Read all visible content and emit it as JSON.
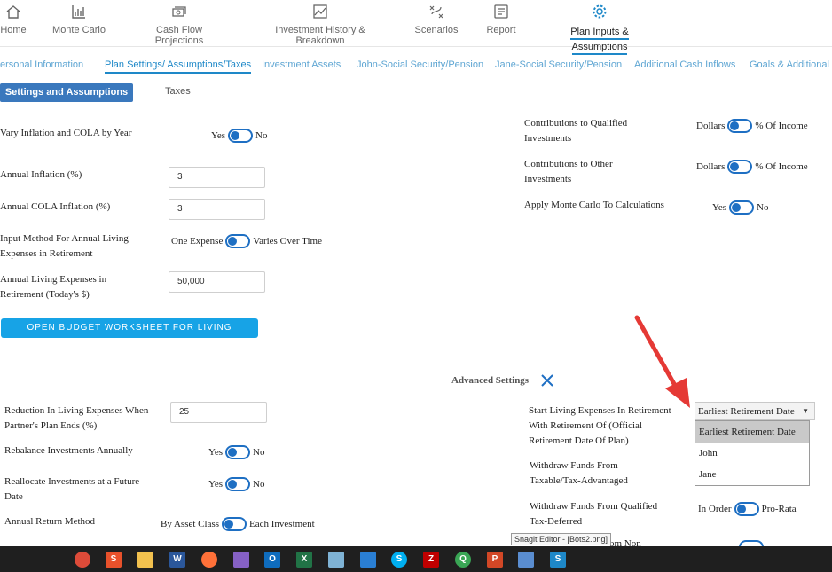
{
  "nav": {
    "items": [
      {
        "label": "Home",
        "icon": "home-icon"
      },
      {
        "label": "Monte Carlo",
        "icon": "bar-chart-icon"
      },
      {
        "label": "Cash Flow Projections",
        "icon": "cash-icon"
      },
      {
        "label": "Investment History & Breakdown",
        "icon": "image-chart-icon"
      },
      {
        "label": "Scenarios",
        "icon": "scenarios-icon"
      },
      {
        "label": "Report",
        "icon": "report-icon"
      },
      {
        "label": "Plan Inputs & Assumptions",
        "icon": "gear-icon"
      }
    ]
  },
  "subtabs": [
    "ersonal Information",
    "Plan Settings/ Assumptions/Taxes",
    "Investment Assets",
    "John-Social Security/Pension",
    "Jane-Social Security/Pension",
    "Additional Cash Inflows",
    "Goals & Additional E"
  ],
  "section_tabs": {
    "active": "Settings and Assumptions",
    "other": "Taxes"
  },
  "settings": {
    "vary_inflation": {
      "label": "Vary Inflation and COLA by Year",
      "left": "Yes",
      "right": "No"
    },
    "annual_inflation": {
      "label": "Annual Inflation (%)",
      "value": "3"
    },
    "annual_cola": {
      "label": "Annual COLA Inflation (%)",
      "value": "3"
    },
    "input_method": {
      "label": "Input Method For Annual Living Expenses in Retirement",
      "left": "One Expense",
      "right": "Varies Over Time"
    },
    "annual_living": {
      "label": "Annual Living Expenses in Retirement (Today's $)",
      "value": "50,000"
    },
    "budget_button": "OPEN BUDGET WORKSHEET FOR LIVING EXPENSES",
    "contrib_qualified": {
      "label": "Contributions to Qualified Investments",
      "left": "Dollars",
      "right": "% Of Income"
    },
    "contrib_other": {
      "label": "Contributions to Other Investments",
      "left": "Dollars",
      "right": "% Of Income"
    },
    "monte_carlo": {
      "label": "Apply Monte Carlo To Calculations",
      "left": "Yes",
      "right": "No"
    }
  },
  "advanced": {
    "title": "Advanced Settings",
    "reduction": {
      "label": "Reduction In Living Expenses When Partner's Plan Ends (%)",
      "value": "25"
    },
    "rebalance": {
      "label": "Rebalance Investments Annually",
      "left": "Yes",
      "right": "No"
    },
    "reallocate": {
      "label": "Reallocate Investments at a Future Date",
      "left": "Yes",
      "right": "No"
    },
    "return_method": {
      "label": "Annual Return Method",
      "left": "By Asset Class",
      "right": "Each Investment"
    },
    "start_living": {
      "label": "Start Living Expenses In Retirement With Retirement Of (Official Retirement Date Of Plan)",
      "selected": "Earliest Retirement Date",
      "options": [
        "Earliest Retirement Date",
        "John",
        "Jane"
      ]
    },
    "withdraw_taxable": {
      "label": "Withdraw Funds From Taxable/Tax-Advantaged"
    },
    "withdraw_qualified": {
      "label": "Withdraw Funds From Qualified Tax-Deferred",
      "left": "In Order",
      "right": "Pro-Rata"
    },
    "withdraw_non": {
      "label": "om Non"
    }
  },
  "tooltip": "Snagit Editor - [Bots2.png]",
  "colors": {
    "accent": "#1e88c8",
    "toggle": "#1e6fc3",
    "arrow": "#e53935",
    "budget_button": "#17a3e6",
    "taskbar": "#1f1f1f"
  },
  "taskbar": {
    "apps": [
      {
        "name": "chrome-icon",
        "glyph": "",
        "color": "#dd4b39"
      },
      {
        "name": "snagit-icon",
        "glyph": "S",
        "color": "#e8512b"
      },
      {
        "name": "file-explorer-icon",
        "glyph": "",
        "color": "#f2c14e"
      },
      {
        "name": "word-icon",
        "glyph": "W",
        "color": "#2b579a"
      },
      {
        "name": "firefox-icon",
        "glyph": "",
        "color": "#ff7139"
      },
      {
        "name": "visual-studio-icon",
        "glyph": "",
        "color": "#8661c5"
      },
      {
        "name": "outlook-icon",
        "glyph": "O",
        "color": "#0f6cbd"
      },
      {
        "name": "excel-icon",
        "glyph": "X",
        "color": "#217346"
      },
      {
        "name": "notepad-icon",
        "glyph": "",
        "color": "#7fb3d5"
      },
      {
        "name": "app-window-icon",
        "glyph": "",
        "color": "#2a7fd4"
      },
      {
        "name": "skype-icon",
        "glyph": "S",
        "color": "#00aff0"
      },
      {
        "name": "filezilla-icon",
        "glyph": "Z",
        "color": "#bf0000"
      },
      {
        "name": "search-app-icon",
        "glyph": "Q",
        "color": "#3aa655"
      },
      {
        "name": "powerpoint-icon",
        "glyph": "P",
        "color": "#d24726"
      },
      {
        "name": "remote-desktop-icon",
        "glyph": "",
        "color": "#5a8dd0"
      },
      {
        "name": "snagit-editor-icon",
        "glyph": "S",
        "color": "#1e88c8"
      }
    ]
  }
}
